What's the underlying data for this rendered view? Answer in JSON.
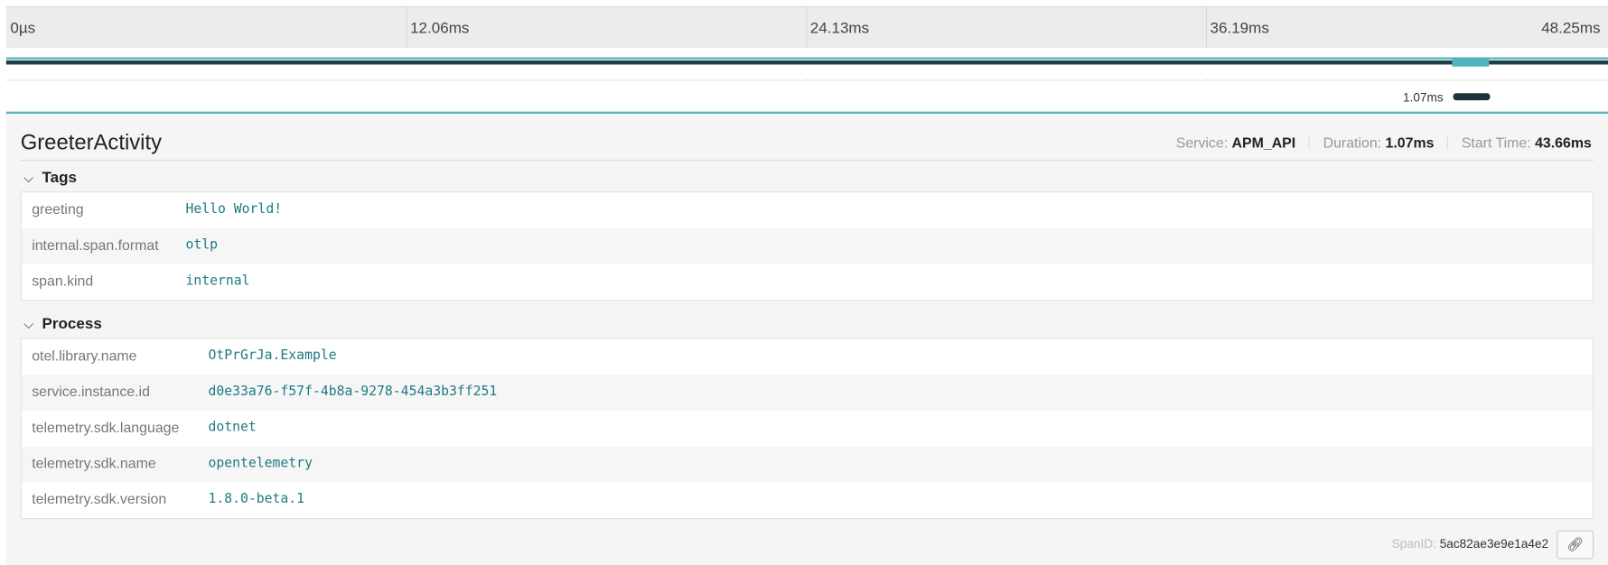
{
  "timeline": {
    "ticks": [
      "0µs",
      "12.06ms",
      "24.13ms",
      "36.19ms",
      "48.25ms"
    ],
    "span_duration": "1.07ms"
  },
  "detail": {
    "title": "GreeterActivity",
    "service_label": "Service:",
    "service_value": "APM_API",
    "duration_label": "Duration:",
    "duration_value": "1.07ms",
    "start_label": "Start Time:",
    "start_value": "43.66ms",
    "tags_heading": "Tags",
    "tags": [
      {
        "key": "greeting",
        "value": "Hello World!"
      },
      {
        "key": "internal.span.format",
        "value": "otlp"
      },
      {
        "key": "span.kind",
        "value": "internal"
      }
    ],
    "process_heading": "Process",
    "process": [
      {
        "key": "otel.library.name",
        "value": "OtPrGrJa.Example"
      },
      {
        "key": "service.instance.id",
        "value": "d0e33a76-f57f-4b8a-9278-454a3b3ff251"
      },
      {
        "key": "telemetry.sdk.language",
        "value": "dotnet"
      },
      {
        "key": "telemetry.sdk.name",
        "value": "opentelemetry"
      },
      {
        "key": "telemetry.sdk.version",
        "value": "1.8.0-beta.1"
      }
    ],
    "spanid_label": "SpanID:",
    "spanid_value": "5ac82ae3e9e1a4e2",
    "copy_icon": "link-icon"
  }
}
